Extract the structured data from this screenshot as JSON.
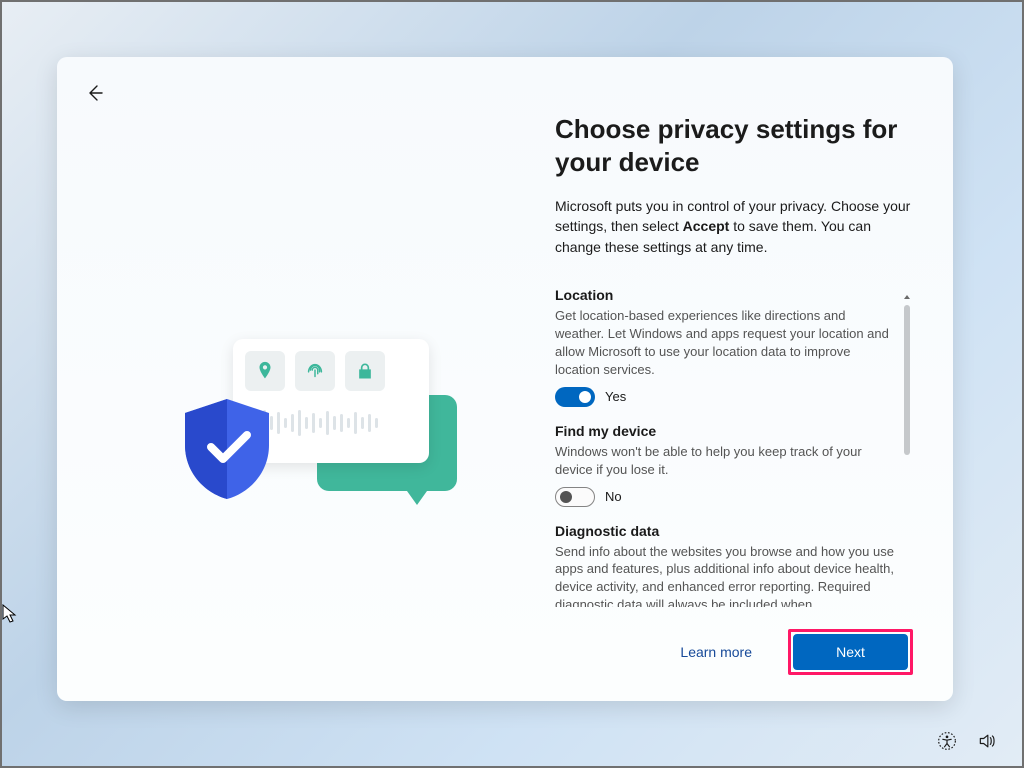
{
  "header": {
    "title": "Choose privacy settings for your device",
    "subtitle_pre": "Microsoft puts you in control of your privacy. Choose your settings, then select ",
    "subtitle_bold": "Accept",
    "subtitle_post": " to save them. You can change these settings at any time."
  },
  "settings": {
    "location": {
      "title": "Location",
      "desc": "Get location-based experiences like directions and weather. Let Windows and apps request your location and allow Microsoft to use your location data to improve location services.",
      "on": true,
      "state_label": "Yes"
    },
    "find_my_device": {
      "title": "Find my device",
      "desc": "Windows won't be able to help you keep track of your device if you lose it.",
      "on": false,
      "state_label": "No"
    },
    "diagnostic": {
      "title": "Diagnostic data",
      "desc": "Send info about the websites you browse and how you use apps and features, plus additional info about device health, device activity, and enhanced error reporting. Required diagnostic data will always be included when"
    }
  },
  "footer": {
    "learn_more": "Learn more",
    "next": "Next"
  },
  "icons": {
    "back": "back-arrow",
    "pin": "location-pin",
    "fingerprint": "fingerprint",
    "lock": "lock",
    "shield": "shield-check",
    "accessibility": "accessibility",
    "volume": "volume"
  },
  "colors": {
    "accent": "#0067c0",
    "teal": "#40b79b",
    "shield_dark": "#2949cc",
    "shield_light": "#3f63e8",
    "highlight": "#ff1866"
  }
}
